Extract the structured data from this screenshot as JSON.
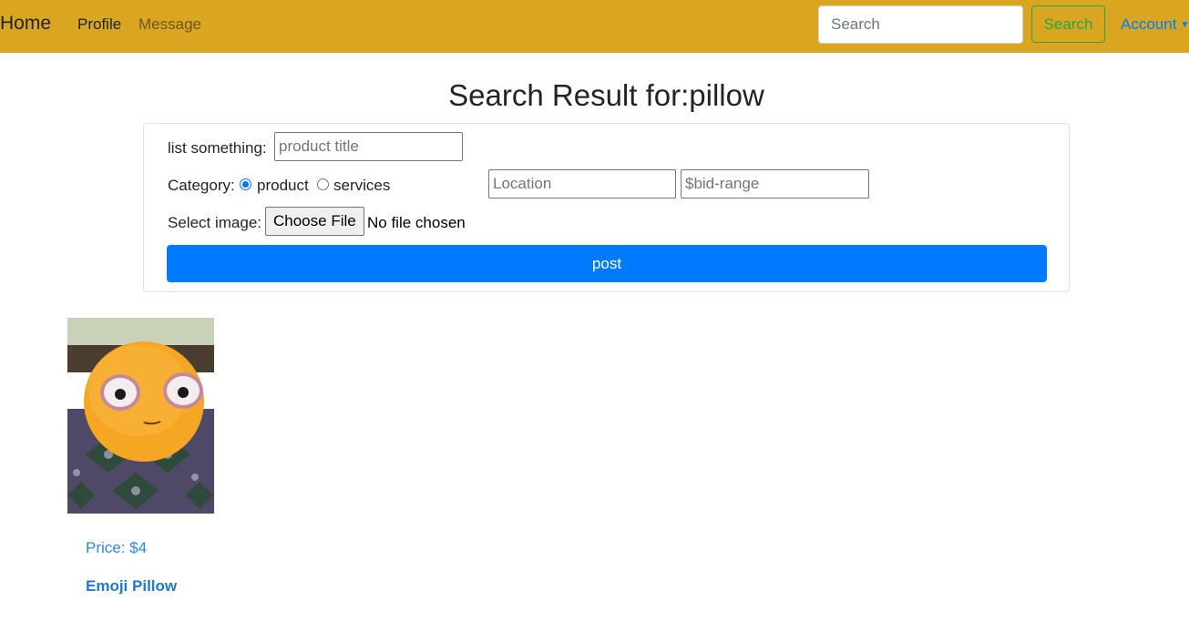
{
  "navbar": {
    "brand": "Home",
    "links": [
      "Profile",
      "Message"
    ],
    "search_placeholder": "Search",
    "search_button": "Search",
    "account": "Account"
  },
  "page": {
    "title": "Search Result for:pillow"
  },
  "form": {
    "list_label": "list something:",
    "title_placeholder": "product title",
    "category_label": "Category:",
    "category_options": [
      "product",
      "services"
    ],
    "category_selected": "product",
    "location_placeholder": "Location",
    "bid_placeholder": "$bid-range",
    "image_label": "Select image:",
    "file_button": "Choose File",
    "file_status": "No file chosen",
    "post_button": "post"
  },
  "results": [
    {
      "price": "Price: $4",
      "name": "Emoji Pillow",
      "image_icon": "emoji-pillow-photo"
    }
  ],
  "colors": {
    "navbar": "#DAA520",
    "primary": "#007bff",
    "success": "#28a745"
  }
}
